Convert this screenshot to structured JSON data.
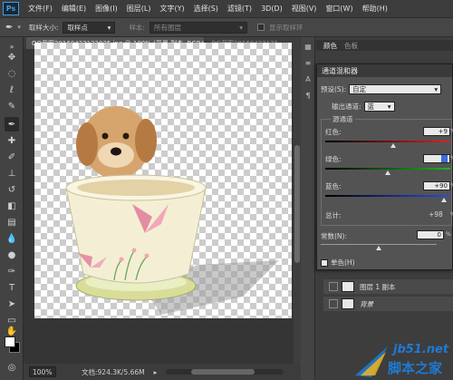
{
  "app": {
    "logo": "Ps",
    "menu": [
      "文件(F)",
      "编辑(E)",
      "图像(I)",
      "图层(L)",
      "文字(Y)",
      "选择(S)",
      "滤镜(T)",
      "3D(D)",
      "视图(V)",
      "窗口(W)",
      "帮助(H)"
    ]
  },
  "options_bar": {
    "sample_size_label": "取样大小:",
    "sample_size_value": "取样点",
    "sample_label": "样本:",
    "sample_value": "所有图层",
    "show_ring_label": "显示取样环"
  },
  "tabs": [
    {
      "label": "QQ截图20160422132025.jpg @ 100% (背景 副本, RGB/8#) *",
      "close": "×"
    },
    {
      "label": "QQ截图20160422131"
    }
  ],
  "status": {
    "zoom": "100%",
    "doc_info": "文档:924.3K/5.66M"
  },
  "panels": {
    "tab_color": "颜色",
    "tab_swatches": "色板"
  },
  "layers": [
    {
      "name": "图层 1 副本"
    },
    {
      "name": "背景"
    }
  ],
  "dialog": {
    "title": "通道混和器",
    "preset_label": "预设(S):",
    "preset_value": "自定",
    "output_label": "输出通道:",
    "output_value": "蓝",
    "source_group": "源通道",
    "channels": [
      {
        "label": "红色:",
        "value": "+9",
        "level_percent": 54
      },
      {
        "label": "绿色:",
        "value": "",
        "level_percent": 50
      },
      {
        "label": "蓝色:",
        "value": "+90",
        "level_percent": 95
      }
    ],
    "percent_sign": "%",
    "total_label": "总计:",
    "total_value": "+98",
    "constant_label": "常数(N):",
    "constant_value": "0",
    "constant_level_percent": 50,
    "mono_label": "单色(H)"
  },
  "watermark": {
    "site": "jb51.net",
    "name": "脚本之家"
  },
  "colors": {
    "foreground": "#ffffff",
    "background": "#000000",
    "watermark": "#1f7ad4"
  }
}
